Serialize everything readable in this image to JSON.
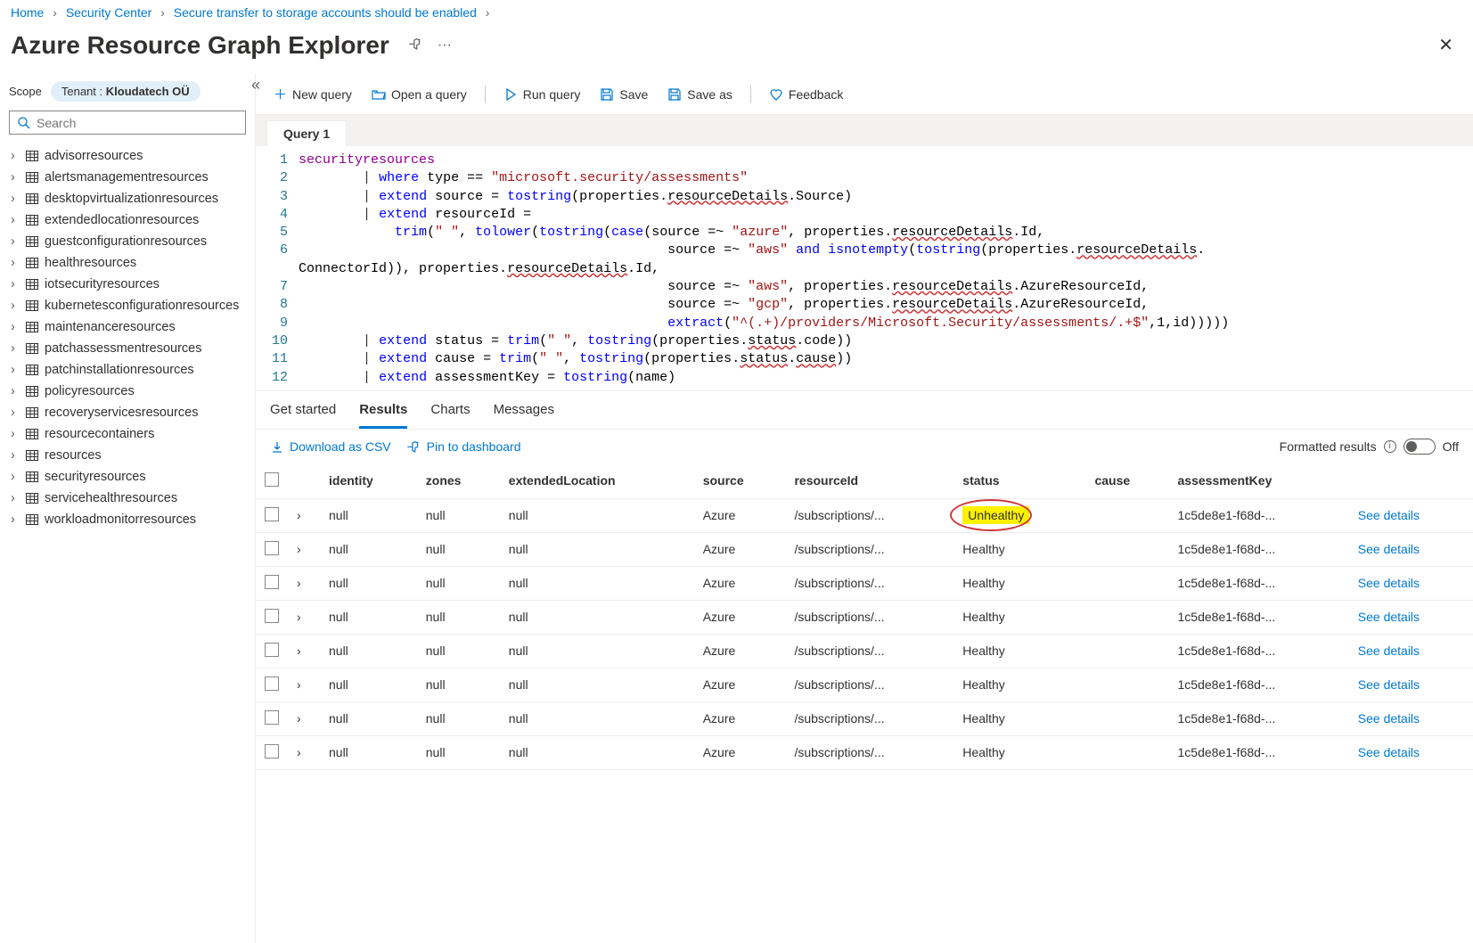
{
  "breadcrumb": [
    {
      "label": "Home"
    },
    {
      "label": "Security Center"
    },
    {
      "label": "Secure transfer to storage accounts should be enabled"
    }
  ],
  "page_title": "Azure Resource Graph Explorer",
  "sidebar": {
    "scope_label": "Scope",
    "tenant_prefix": "Tenant : ",
    "tenant_name": "Kloudatech OÜ",
    "search_placeholder": "Search",
    "tables": [
      "advisorresources",
      "alertsmanagementresources",
      "desktopvirtualizationresources",
      "extendedlocationresources",
      "guestconfigurationresources",
      "healthresources",
      "iotsecurityresources",
      "kubernetesconfigurationresources",
      "maintenanceresources",
      "patchassessmentresources",
      "patchinstallationresources",
      "policyresources",
      "recoveryservicesresources",
      "resourcecontainers",
      "resources",
      "securityresources",
      "servicehealthresources",
      "workloadmonitorresources"
    ]
  },
  "toolbar": {
    "new_query": "New query",
    "open_query": "Open a query",
    "run_query": "Run query",
    "save": "Save",
    "save_as": "Save as",
    "feedback": "Feedback"
  },
  "query_tab": "Query 1",
  "editor_lines": [
    "securityresources",
    "        | where type == \"microsoft.security/assessments\"",
    "        | extend source = tostring(properties.resourceDetails.Source)",
    "        | extend resourceId =",
    "            trim(\" \", tolower(tostring(case(source =~ \"azure\", properties.resourceDetails.Id,",
    "                                              source =~ \"aws\" and isnotempty(tostring(properties.resourceDetails.ConnectorId)), properties.resourceDetails.Id,",
    "                                              source =~ \"aws\", properties.resourceDetails.AzureResourceId,",
    "                                              source =~ \"gcp\", properties.resourceDetails.AzureResourceId,",
    "                                              extract(\"^(.+)/providers/Microsoft.Security/assessments/.+$\",1,id)))))",
    "        | extend status = trim(\" \", tostring(properties.status.code))",
    "        | extend cause = trim(\" \", tostring(properties.status.cause))",
    "        | extend assessmentKey = tostring(name)"
  ],
  "result_tabs": {
    "get_started": "Get started",
    "results": "Results",
    "charts": "Charts",
    "messages": "Messages"
  },
  "result_toolbar": {
    "download_csv": "Download as CSV",
    "pin_dashboard": "Pin to dashboard",
    "formatted_results": "Formatted results",
    "toggle_state": "Off"
  },
  "columns": [
    "identity",
    "zones",
    "extendedLocation",
    "source",
    "resourceId",
    "status",
    "cause",
    "assessmentKey"
  ],
  "see_details_label": "See details",
  "rows": [
    {
      "identity": "null",
      "zones": "null",
      "extendedLocation": "null",
      "source": "Azure",
      "resourceId": "/subscriptions/...",
      "status": "Unhealthy",
      "cause": "",
      "assessmentKey": "1c5de8e1-f68d-..."
    },
    {
      "identity": "null",
      "zones": "null",
      "extendedLocation": "null",
      "source": "Azure",
      "resourceId": "/subscriptions/...",
      "status": "Healthy",
      "cause": "",
      "assessmentKey": "1c5de8e1-f68d-..."
    },
    {
      "identity": "null",
      "zones": "null",
      "extendedLocation": "null",
      "source": "Azure",
      "resourceId": "/subscriptions/...",
      "status": "Healthy",
      "cause": "",
      "assessmentKey": "1c5de8e1-f68d-..."
    },
    {
      "identity": "null",
      "zones": "null",
      "extendedLocation": "null",
      "source": "Azure",
      "resourceId": "/subscriptions/...",
      "status": "Healthy",
      "cause": "",
      "assessmentKey": "1c5de8e1-f68d-..."
    },
    {
      "identity": "null",
      "zones": "null",
      "extendedLocation": "null",
      "source": "Azure",
      "resourceId": "/subscriptions/...",
      "status": "Healthy",
      "cause": "",
      "assessmentKey": "1c5de8e1-f68d-..."
    },
    {
      "identity": "null",
      "zones": "null",
      "extendedLocation": "null",
      "source": "Azure",
      "resourceId": "/subscriptions/...",
      "status": "Healthy",
      "cause": "",
      "assessmentKey": "1c5de8e1-f68d-..."
    },
    {
      "identity": "null",
      "zones": "null",
      "extendedLocation": "null",
      "source": "Azure",
      "resourceId": "/subscriptions/...",
      "status": "Healthy",
      "cause": "",
      "assessmentKey": "1c5de8e1-f68d-..."
    },
    {
      "identity": "null",
      "zones": "null",
      "extendedLocation": "null",
      "source": "Azure",
      "resourceId": "/subscriptions/...",
      "status": "Healthy",
      "cause": "",
      "assessmentKey": "1c5de8e1-f68d-..."
    }
  ]
}
